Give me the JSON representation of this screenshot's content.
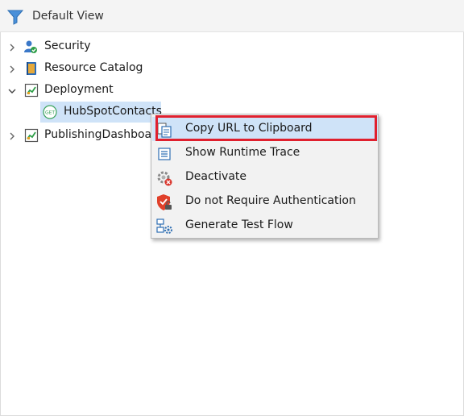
{
  "header": {
    "title": "Default View"
  },
  "tree": [
    {
      "label": "Security",
      "icon": "security-icon",
      "expanded": false
    },
    {
      "label": "Resource Catalog",
      "icon": "book-icon",
      "expanded": false
    },
    {
      "label": "Deployment",
      "icon": "deployment-icon",
      "expanded": true
    },
    {
      "label": "HubSpotContacts",
      "icon": "get-endpoint-icon",
      "selected": true
    },
    {
      "label": "PublishingDashboard",
      "icon": "deployment-icon",
      "expanded": false
    }
  ],
  "context_menu": {
    "items": [
      {
        "label": "Copy URL to Clipboard",
        "icon": "copy-icon",
        "highlighted": true
      },
      {
        "label": "Show Runtime Trace",
        "icon": "trace-icon"
      },
      {
        "label": "Deactivate",
        "icon": "deactivate-gear-icon"
      },
      {
        "label": "Do not Require Authentication",
        "icon": "shield-icon"
      },
      {
        "label": "Generate Test Flow",
        "icon": "test-flow-icon"
      }
    ]
  },
  "colors": {
    "selection": "#cfe3f8",
    "highlight_border": "#e0202e",
    "accent": "#2f7fd3"
  }
}
